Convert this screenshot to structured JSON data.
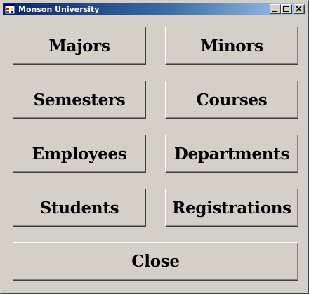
{
  "window": {
    "title": "Monson University",
    "controls": {
      "minimize_icon": "minimize-icon",
      "maximize_icon": "maximize-icon",
      "close_icon": "close-icon"
    }
  },
  "buttons": {
    "majors": "Majors",
    "minors": "Minors",
    "semesters": "Semesters",
    "courses": "Courses",
    "employees": "Employees",
    "departments": "Departments",
    "students": "Students",
    "registrations": "Registrations",
    "close": "Close"
  },
  "colors": {
    "face": "#d4d0c8",
    "titlebar_start": "#0a246a",
    "titlebar_end": "#a6caf0",
    "text": "#000000"
  }
}
